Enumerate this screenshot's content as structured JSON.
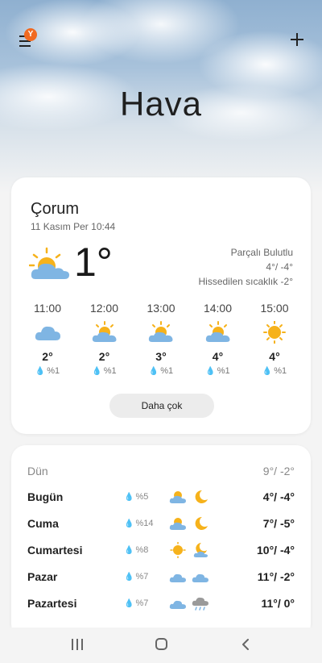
{
  "header": {
    "title": "Hava",
    "menu_badge": "Y",
    "menu_icon": "hamburger-menu-icon",
    "add_icon": "plus-icon"
  },
  "current": {
    "city": "Çorum",
    "datetime": "11 Kasım Per 10:44",
    "temp": "1°",
    "icon": "partly-cloudy-icon",
    "condition": "Parçalı Bulutlu",
    "high_low": "4°/ -4°",
    "feels_like": "Hissedilen sıcaklık -2°"
  },
  "hourly": [
    {
      "time": "11:00",
      "icon": "cloudy-icon",
      "temp": "2°",
      "rain": "%1"
    },
    {
      "time": "12:00",
      "icon": "partly-cloudy-icon",
      "temp": "2°",
      "rain": "%1"
    },
    {
      "time": "13:00",
      "icon": "partly-cloudy-icon",
      "temp": "3°",
      "rain": "%1"
    },
    {
      "time": "14:00",
      "icon": "partly-cloudy-icon",
      "temp": "4°",
      "rain": "%1"
    },
    {
      "time": "15:00",
      "icon": "sunny-icon",
      "temp": "4°",
      "rain": "%1"
    }
  ],
  "more_button": "Daha çok",
  "daily": [
    {
      "day": "Dün",
      "rain": "",
      "range": "9°/ -2°"
    },
    {
      "day": "Bugün",
      "rain": "%5",
      "icon_day": "partly-cloudy-icon",
      "icon_night": "moon-icon",
      "range": "4°/ -4°"
    },
    {
      "day": "Cuma",
      "rain": "%14",
      "icon_day": "partly-cloudy-icon",
      "icon_night": "moon-icon",
      "range": "7°/ -5°"
    },
    {
      "day": "Cumartesi",
      "rain": "%8",
      "icon_day": "sunny-icon",
      "icon_night": "moon-cloud-icon",
      "range": "10°/ -4°"
    },
    {
      "day": "Pazar",
      "rain": "%7",
      "icon_day": "cloudy-icon",
      "icon_night": "cloudy-icon",
      "range": "11°/ -2°"
    },
    {
      "day": "Pazartesi",
      "rain": "%7",
      "icon_day": "cloudy-icon",
      "icon_night": "rain-cloud-icon",
      "range": "11°/ 0°"
    }
  ],
  "colors": {
    "badge": "#f16a21",
    "sun": "#f6b21b",
    "cloud": "#7fb5e3",
    "drop": "#8cb2d9"
  }
}
